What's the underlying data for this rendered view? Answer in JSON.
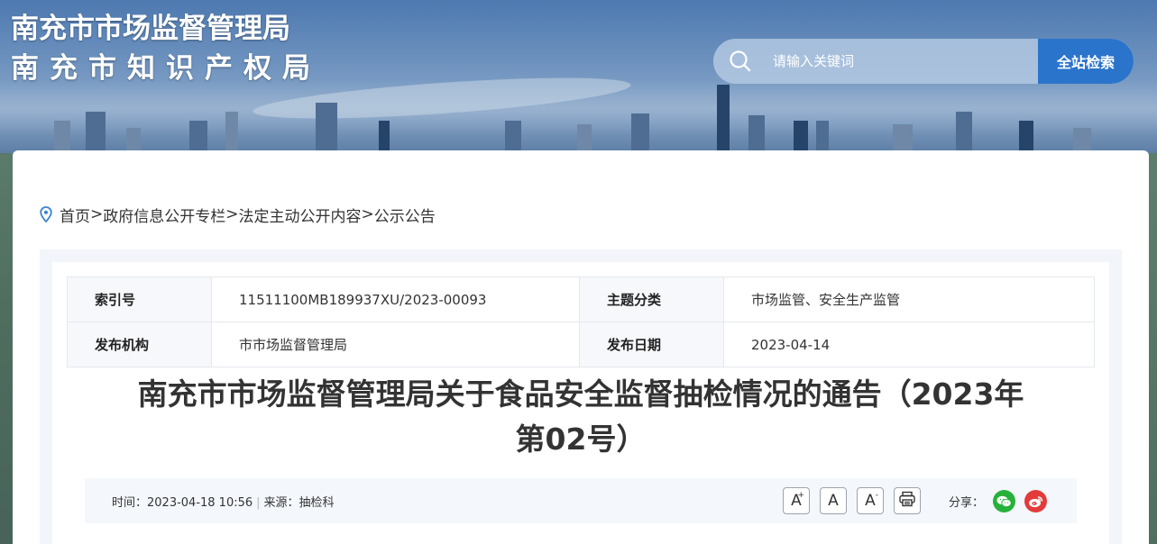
{
  "header": {
    "title_line1": "南充市市场监督管理局",
    "title_line2": "南充市知识产权局"
  },
  "search": {
    "placeholder": "请输入关键词",
    "button_label": "全站检索",
    "icon": "search-icon"
  },
  "breadcrumb": {
    "icon": "location-pin-icon",
    "items": [
      "首页",
      "政府信息公开专栏",
      "法定主动公开内容",
      "公示公告"
    ],
    "separator": ">"
  },
  "meta": {
    "index_label": "索引号",
    "index_value": "11511100MB189937XU/2023-00093",
    "topic_label": "主题分类",
    "topic_value": "市场监管、安全生产监管",
    "publisher_label": "发布机构",
    "publisher_value": "市市场监督管理局",
    "date_label": "发布日期",
    "date_value": "2023-04-14"
  },
  "article": {
    "title_line1": "南充市市场监督管理局关于食品安全监督抽检情况的通告（2023年",
    "title_line2": "第02号）"
  },
  "infobar": {
    "time_text": "时间：2023-04-18 10:56",
    "divider": "|",
    "source_text": "来源：抽检科",
    "font_increase": "A",
    "font_increase_sup": "+",
    "font_normal": "A",
    "font_decrease": "A",
    "font_decrease_sup": "-",
    "print_icon": "print-icon",
    "share_label": "分享：",
    "wechat_icon": "wechat-icon",
    "weibo_icon": "weibo-icon"
  },
  "colors": {
    "accent": "#2b74cc",
    "wechat": "#26b23a",
    "weibo": "#e33a3a"
  }
}
